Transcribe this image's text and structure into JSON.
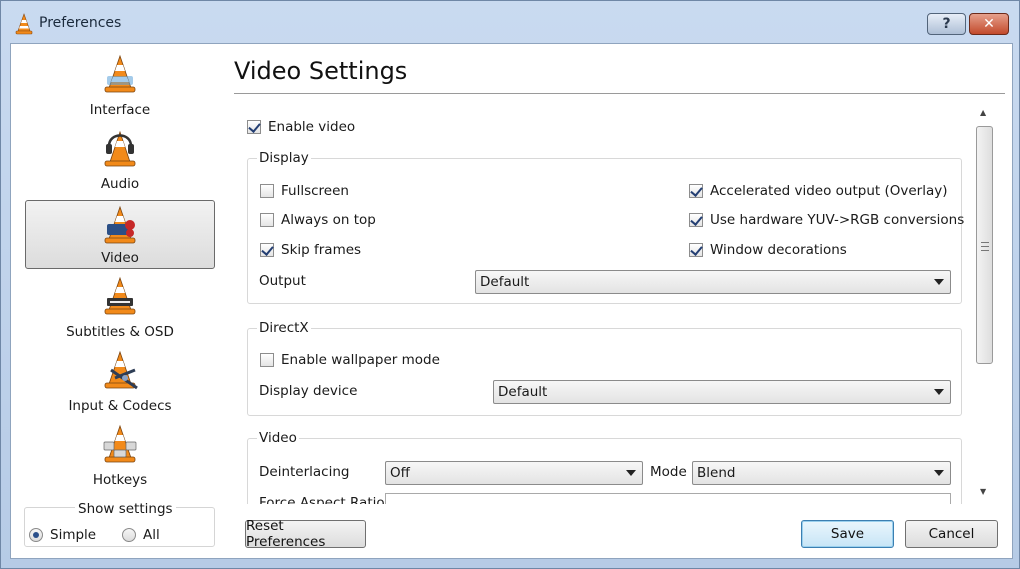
{
  "window": {
    "title": "Preferences",
    "help_label": "?",
    "close_label": "✕"
  },
  "sidebar": {
    "items": [
      {
        "label": "Interface",
        "icon": "interface-cone-icon"
      },
      {
        "label": "Audio",
        "icon": "audio-headphones-cone-icon"
      },
      {
        "label": "Video",
        "icon": "video-cone-icon",
        "selected": true
      },
      {
        "label": "Subtitles & OSD",
        "icon": "subtitles-cone-icon"
      },
      {
        "label": "Input & Codecs",
        "icon": "codecs-cone-icon"
      },
      {
        "label": "Hotkeys",
        "icon": "hotkeys-cone-icon"
      }
    ],
    "show_settings": {
      "legend": "Show settings",
      "simple_label": "Simple",
      "all_label": "All",
      "selected": "Simple"
    }
  },
  "main": {
    "title": "Video Settings",
    "enable_video": {
      "label": "Enable video",
      "checked": true
    },
    "display": {
      "title": "Display",
      "fullscreen": {
        "label": "Fullscreen",
        "checked": false
      },
      "always_on_top": {
        "label": "Always on top",
        "checked": false
      },
      "skip_frames": {
        "label": "Skip frames",
        "checked": true
      },
      "accelerated": {
        "label": "Accelerated video output (Overlay)",
        "checked": true
      },
      "hw_yuv": {
        "label": "Use hardware YUV->RGB conversions",
        "checked": true
      },
      "window_decorations": {
        "label": "Window decorations",
        "checked": true
      },
      "output_label": "Output",
      "output_value": "Default"
    },
    "directx": {
      "title": "DirectX",
      "wallpaper": {
        "label": "Enable wallpaper mode",
        "checked": false
      },
      "display_device_label": "Display device",
      "display_device_value": "Default"
    },
    "video": {
      "title": "Video",
      "deinterlacing_label": "Deinterlacing",
      "deinterlacing_value": "Off",
      "mode_label": "Mode",
      "mode_value": "Blend",
      "force_aspect_label": "Force Aspect Ratio"
    }
  },
  "footer": {
    "reset_label": "Reset Preferences",
    "save_label": "Save",
    "cancel_label": "Cancel"
  },
  "colors": {
    "cone_orange": "#f28a1a",
    "cone_white": "#ffffff",
    "selection_border": "#6a6a6a",
    "default_button_border": "#3c7fb1"
  }
}
